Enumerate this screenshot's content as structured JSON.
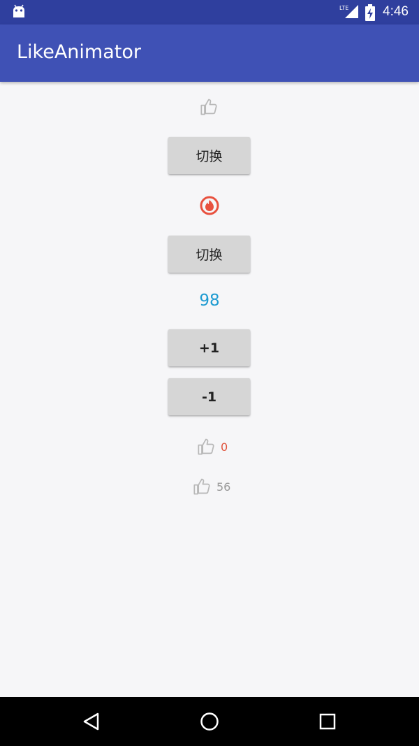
{
  "status_bar": {
    "time": "4:46",
    "network_label": "LTE",
    "icons": [
      "android-icon",
      "lte-signal-icon",
      "battery-charging-icon"
    ]
  },
  "app_bar": {
    "title": "LikeAnimator"
  },
  "content": {
    "like_icon_top": "thumb-up-icon",
    "switch_button_1": "切换",
    "fire_icon": "fire-icon",
    "switch_button_2": "切换",
    "counter_value": "98",
    "plus_button": "+1",
    "minus_button": "-1",
    "like_row_1": {
      "icon": "thumb-up-icon",
      "count": "0",
      "count_color": "#e0533c"
    },
    "like_row_2": {
      "icon": "thumb-up-icon",
      "count": "56",
      "count_color": "#9a9a9a"
    }
  },
  "nav_bar": {
    "icons": [
      "back-icon",
      "home-icon",
      "recents-icon"
    ]
  },
  "colors": {
    "status_bar": "#2f3f9e",
    "app_bar": "#3f51b5",
    "background": "#f6f6f8",
    "counter": "#1e9bd1",
    "fire": "#e8513f",
    "button": "#d6d6d6"
  }
}
